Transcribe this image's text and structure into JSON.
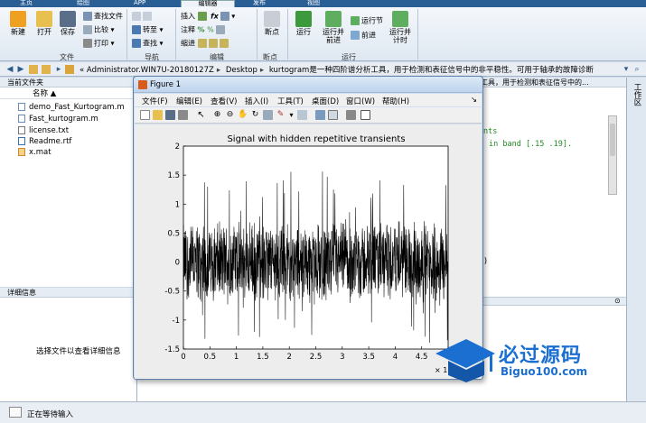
{
  "toptabs": [
    "主页",
    "绘图",
    "APP",
    "编辑器",
    "发布",
    "视图"
  ],
  "ribbon": {
    "new": "新建",
    "open": "打开",
    "save": "保存",
    "find_files": "查找文件",
    "compare": "比较",
    "print": "打印",
    "insert": "插入",
    "comment": "注释",
    "indent": "缩进",
    "goto": "转至",
    "find": "查找",
    "breakpoints": "断点",
    "run": "运行",
    "run_advance": "运行并\n前进",
    "run_section": "运行节",
    "advance": "前进",
    "run_time": "运行并\n计时",
    "groups": {
      "file": "文件",
      "navigate": "导航",
      "edit": "编辑",
      "breakpoints": "断点",
      "run": "运行"
    }
  },
  "address": {
    "path": [
      "«",
      "Administrator.WIN7U-20180127Z",
      "Desktop",
      "kurtogram是一种四阶谱分析工具，用于检测和表征信号中的非平稳性。可用于轴承的故障诊断"
    ]
  },
  "file_panel": {
    "title": "当前文件夹",
    "column": "名称",
    "files": [
      "demo_Fast_Kurtogram.m",
      "Fast_kurtogram.m",
      "license.txt",
      "Readme.rtf",
      "x.mat"
    ]
  },
  "detail_panel": {
    "title": "详细信息",
    "text": "选择文件以查看详细信息"
  },
  "editor": {
    "header": "工具，用于检测和表征信号中的...",
    "line1": "nts",
    "line2": "in band [.15 .19].",
    "line3": ")"
  },
  "workspace": {
    "label": "工作区"
  },
  "status": {
    "text": "正在等待输入"
  },
  "figure": {
    "title": "Figure 1",
    "menu": [
      "文件(F)",
      "编辑(E)",
      "查看(V)",
      "插入(I)",
      "工具(T)",
      "桌面(D)",
      "窗口(W)",
      "帮助(H)"
    ]
  },
  "chart_data": {
    "type": "line",
    "title": "Signal with hidden repetitive transients",
    "xlim": [
      0,
      5
    ],
    "ylim": [
      -1.5,
      2
    ],
    "xticks": [
      "0",
      "0.5",
      "1",
      "1.5",
      "2",
      "2.5",
      "3",
      "3.5",
      "4",
      "4.5",
      "5"
    ],
    "yticks": [
      "-1.5",
      "-1",
      "-0.5",
      "0",
      "0.5",
      "1",
      "1.5",
      "2"
    ],
    "x_multiplier": "× 10⁴",
    "noise_band": [
      -0.75,
      0.75
    ],
    "spike_range": [
      -1.4,
      1.6
    ]
  },
  "watermark": {
    "main": "必过源码",
    "sub": "Biguo100.com"
  },
  "colors": {
    "ribbon_tab": "#2a5f96",
    "accent": "#1a6fd1",
    "signal": "#000000"
  }
}
